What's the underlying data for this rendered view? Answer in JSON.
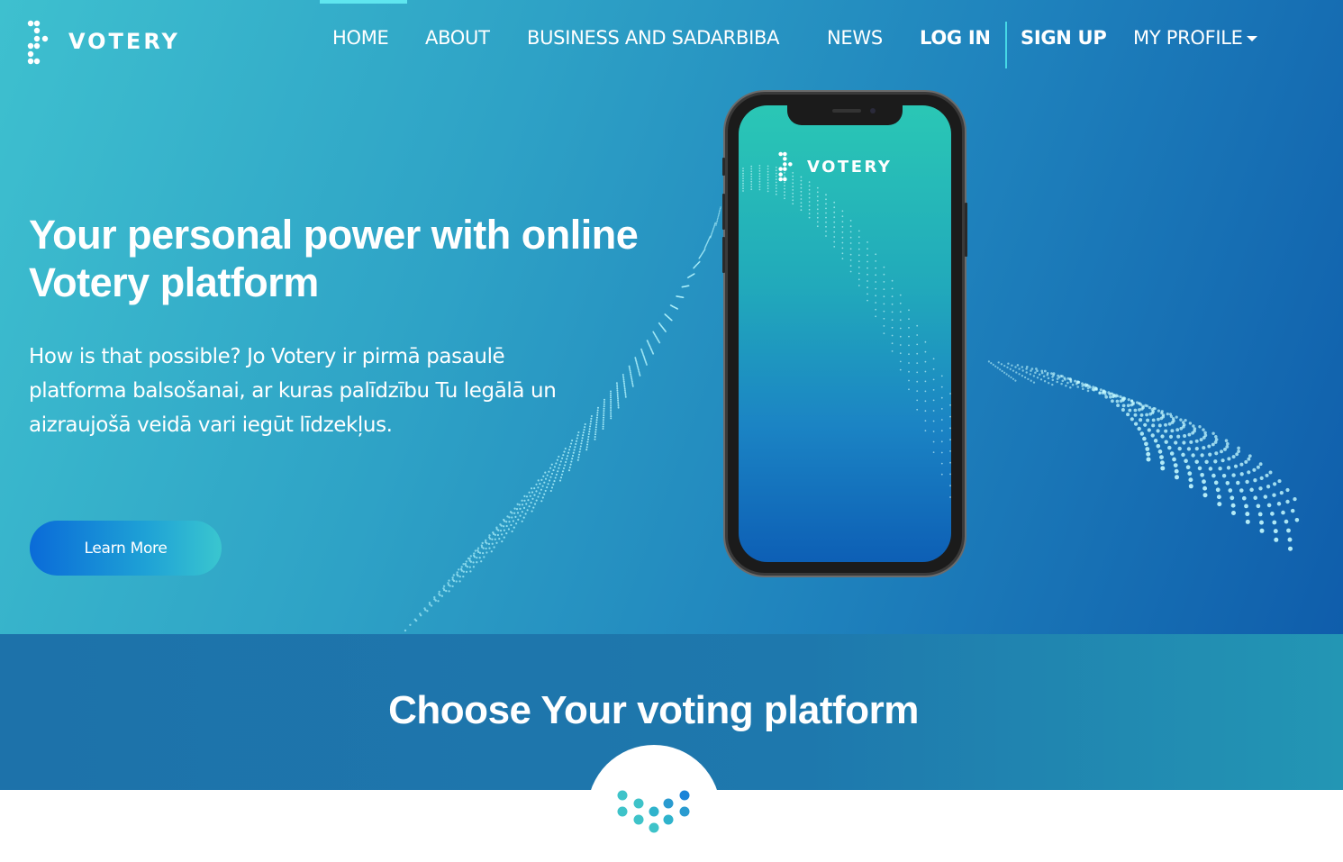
{
  "brand": {
    "name": "VOTERY",
    "colors": {
      "accent": "#5fe6ef",
      "primary": "#1f83bd",
      "button_start": "#0a6bd8",
      "button_end": "#3ac6cf"
    }
  },
  "nav": {
    "items": [
      {
        "label": "HOME",
        "active": true
      },
      {
        "label": "ABOUT"
      },
      {
        "label": "BUSINESS AND SADARBIBA"
      },
      {
        "label": "NEWS"
      },
      {
        "label": "LOG IN"
      },
      {
        "label": "SIGN UP"
      },
      {
        "label": "MY PROFILE",
        "icon": "caret-down-icon"
      }
    ]
  },
  "hero": {
    "title_line1": "Your personal power with online",
    "title_line2": "Votery platform",
    "desc_line1": "How is that possible? Jo Votery ir pirmā pasaulē",
    "desc_line2": "platforma balsošanai, ar kuras palīdzību Tu legālā un",
    "desc_line3": "aizraujošā veidā vari iegūt līdzekļus.",
    "cta_label": "Learn More"
  },
  "phone": {
    "logo_text": "VOTERY"
  },
  "choose": {
    "title": "Choose Your voting platform"
  }
}
